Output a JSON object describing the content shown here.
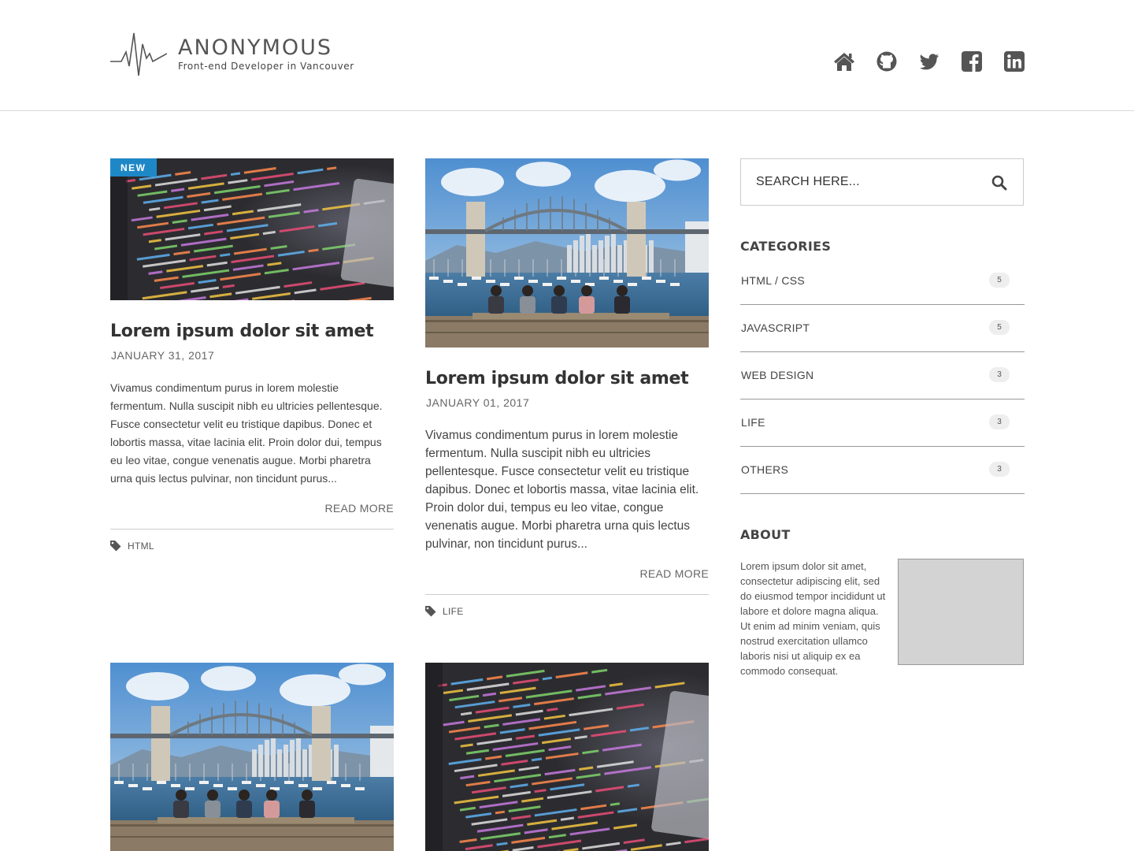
{
  "site": {
    "name": "ANONYMOUS",
    "tagline": "Front-end Developer in Vancouver"
  },
  "nav_icons": [
    "home-icon",
    "github-icon",
    "twitter-icon",
    "facebook-icon",
    "linkedin-icon"
  ],
  "colors": {
    "accent": "#1e88c7",
    "icon": "#555555",
    "divider": "#cccccc"
  },
  "posts": [
    {
      "badge": "NEW",
      "image": "code-screen",
      "title": "Lorem ipsum dolor sit amet",
      "date": "JANUARY 31, 2017",
      "excerpt": "Vivamus condimentum purus in lorem molestie fermentum. Nulla suscipit nibh eu ultricies pellentesque. Fusce consectetur velit eu tristique dapibus. Donec et lobortis massa, vitae lacinia elit. Proin dolor dui, tempus eu leo vitae, congue venenatis augue. Morbi pharetra urna quis lectus pulvinar, non tincidunt purus...",
      "read_more": "READ MORE",
      "tag": "HTML"
    },
    {
      "image": "bridge-photo",
      "title": "Lorem ipsum dolor sit amet",
      "date": "JANUARY 01, 2017",
      "excerpt": "Vivamus condimentum purus in lorem molestie fermentum. Nulla suscipit nibh eu ultricies pellentesque. Fusce consectetur velit eu tristique dapibus. Donec et lobortis massa, vitae lacinia elit. Proin dolor dui, tempus eu leo vitae, congue venenatis augue. Morbi pharetra urna quis lectus pulvinar, non tincidunt purus...",
      "read_more": "READ MORE",
      "tag": "LIFE"
    },
    {
      "image": "bridge-photo"
    },
    {
      "image": "code-screen"
    }
  ],
  "search": {
    "placeholder": "SEARCH HERE..."
  },
  "categories": {
    "heading": "CATEGORIES",
    "items": [
      {
        "name": "HTML / CSS",
        "count": "5"
      },
      {
        "name": "JAVASCRIPT",
        "count": "5"
      },
      {
        "name": "WEB DESIGN",
        "count": "3"
      },
      {
        "name": "LIFE",
        "count": "3"
      },
      {
        "name": "OTHERS",
        "count": "3"
      }
    ]
  },
  "about": {
    "heading": "ABOUT",
    "text": "Lorem ipsum dolor sit amet, consectetur adipiscing elit, sed do eiusmod tempor incididunt ut labore et dolore magna aliqua. Ut enim ad minim veniam, quis nostrud exercitation ullamco laboris nisi ut aliquip ex ea commodo consequat."
  }
}
